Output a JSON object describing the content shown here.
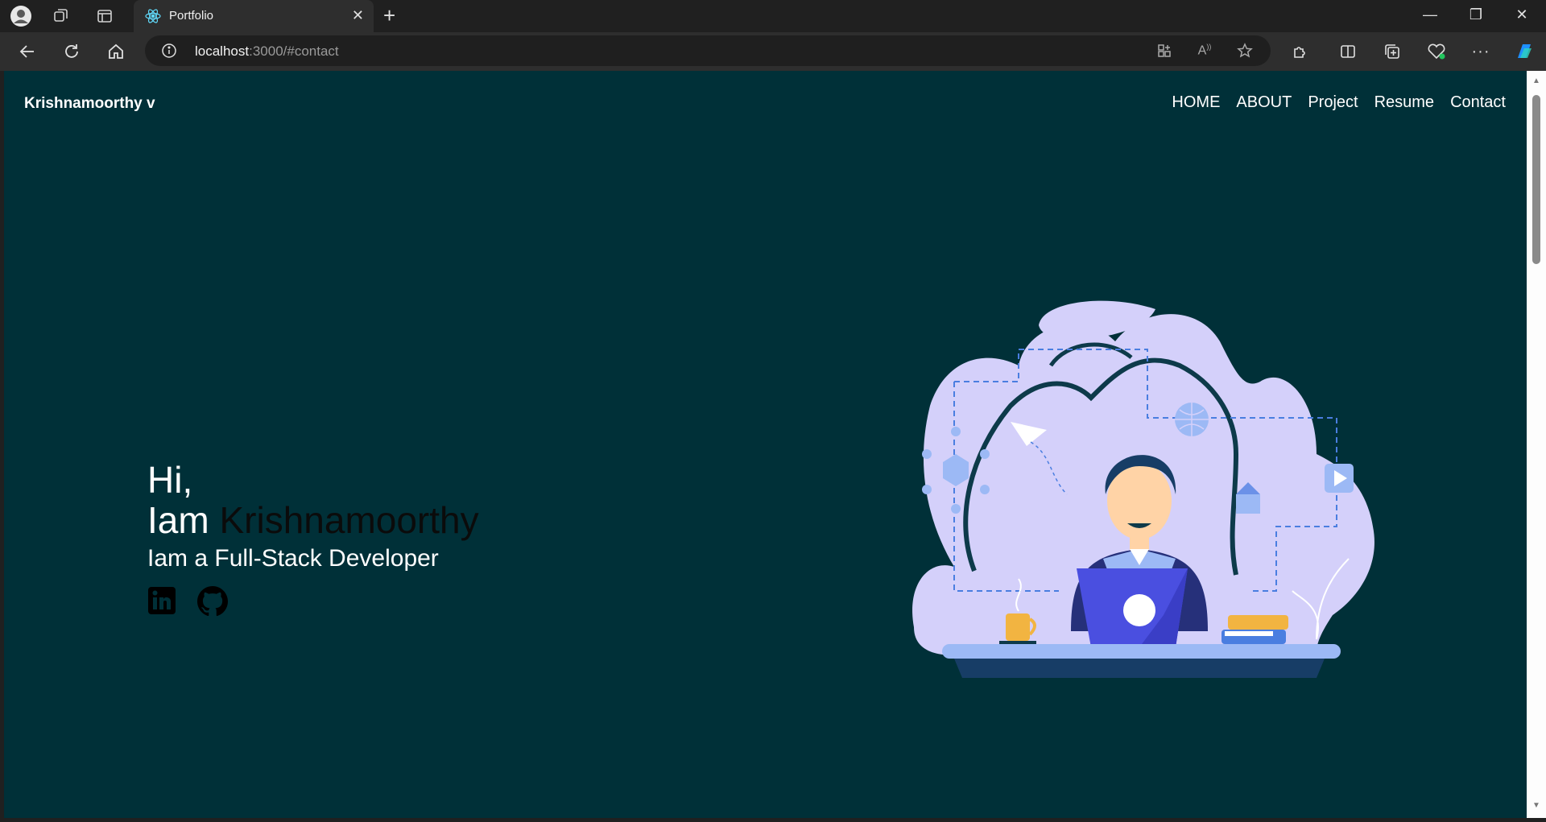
{
  "browser": {
    "tab_title": "Portfolio",
    "url_host": "localhost",
    "url_rest": ":3000/#contact",
    "tab_close": "✕",
    "new_tab": "+",
    "controls": {
      "minimize": "—",
      "maximize": "❐",
      "close": "✕"
    },
    "toolbar_icons": [
      "back-icon",
      "refresh-icon",
      "home-icon",
      "info-icon",
      "app-icon",
      "read-aloud-icon",
      "favorite-icon",
      "extensions-icon",
      "split-screen-icon",
      "collections-icon",
      "performance-icon",
      "more-icon",
      "copilot-icon"
    ]
  },
  "page": {
    "brand": "Krishnamoorthy v",
    "nav": [
      "HOME",
      "ABOUT",
      "Project",
      "Resume",
      "Contact"
    ],
    "hero": {
      "greeting": "Hi,",
      "iam": "Iam",
      "name": "Krishnamoorthy",
      "role": "Iam a Full-Stack Developer"
    },
    "social_icons": [
      "linkedin-icon",
      "github-icon"
    ]
  },
  "colors": {
    "page_bg": "#003038",
    "text": "#ffffff",
    "name_text": "#0b0b0b",
    "illustration_blob": "#d4d0fa",
    "illustration_accent": "#4a4fe0"
  }
}
